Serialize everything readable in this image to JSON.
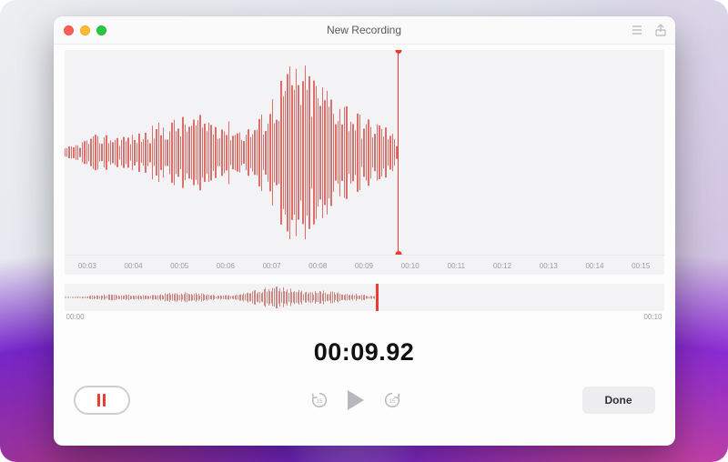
{
  "window": {
    "title": "New Recording"
  },
  "toolbar_icons": {
    "list": "list-icon",
    "share": "share-icon"
  },
  "playback": {
    "current_time": "00:09.92",
    "ruler_ticks": [
      "00:03",
      "00:04",
      "00:05",
      "00:06",
      "00:07",
      "00:08",
      "00:09",
      "00:10",
      "00:11",
      "00:12",
      "00:13",
      "00:14",
      "00:15"
    ],
    "overview_start": "00:00",
    "overview_end": "00:10",
    "playhead_ratio": 0.556,
    "overview_playhead_ratio": 0.52
  },
  "controls": {
    "record_state": "pause",
    "skip_back": "15",
    "skip_fwd": "15",
    "done_label": "Done"
  },
  "colors": {
    "accent": "#e93c33",
    "wave": "#d9605b"
  }
}
